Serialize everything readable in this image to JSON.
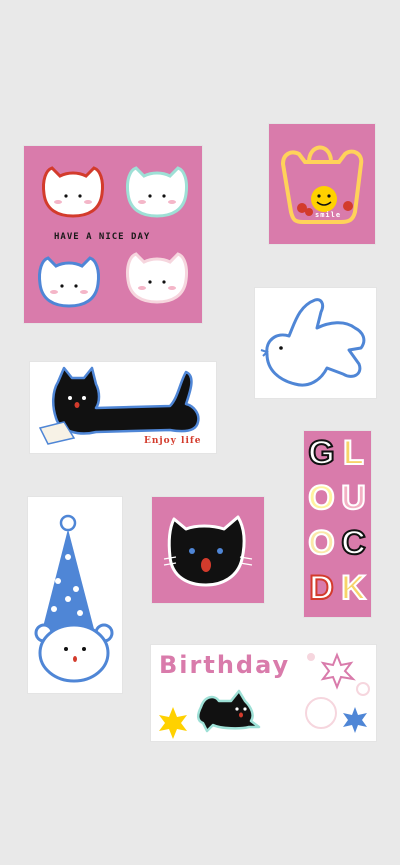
{
  "stickers": {
    "nice_day_caption": "HAVE A NICE DAY",
    "smile_caption": "smile",
    "enjoy_caption": "Enjoy life",
    "birthday_caption": "Birthday",
    "good_luck_letters": [
      "G",
      "O",
      "O",
      "D",
      "L",
      "U",
      "C",
      "K"
    ]
  },
  "colors": {
    "background": "#e9e9e9",
    "pink": "#d97bab",
    "blue": "#4f86d6",
    "black": "#111111",
    "red": "#d33b2c"
  }
}
